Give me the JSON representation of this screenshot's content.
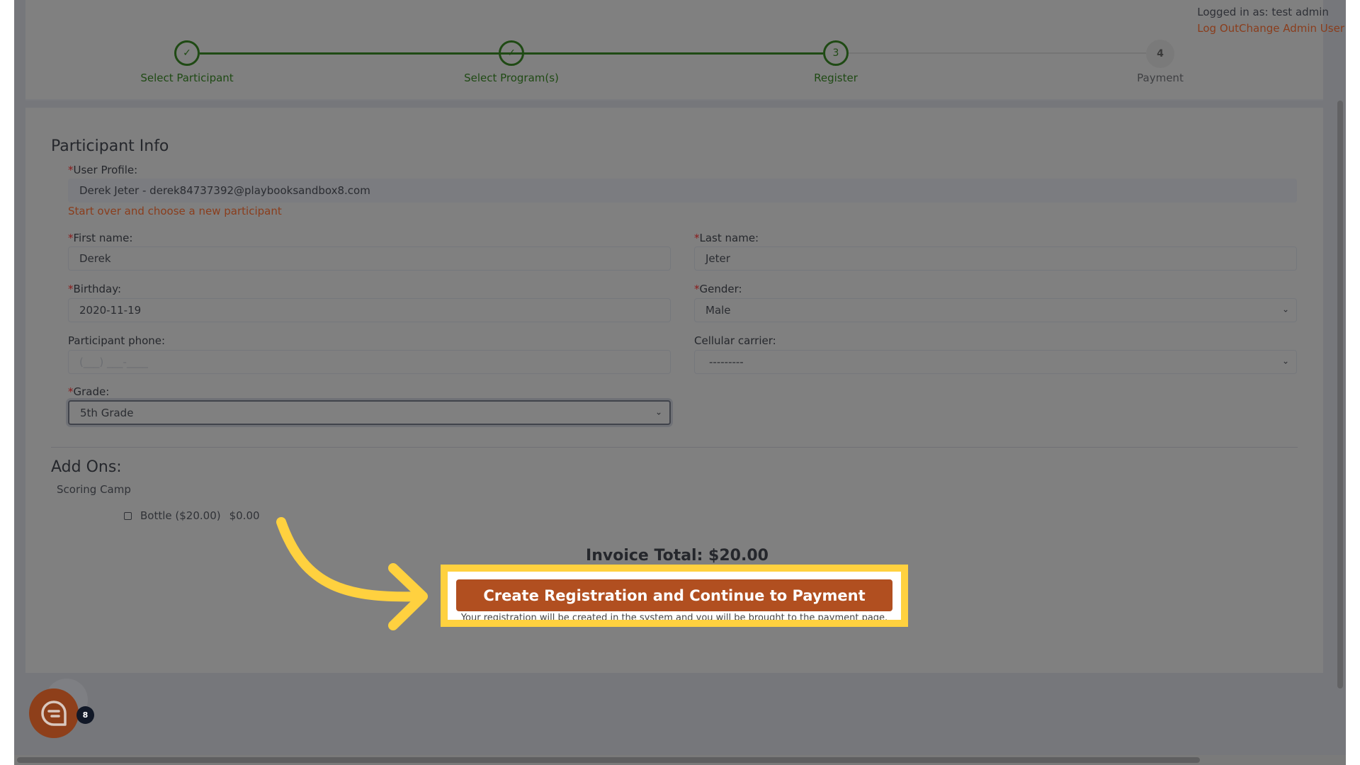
{
  "header": {
    "logged_in_text": "Logged in as: test admin",
    "logout_link": "Log Out",
    "change_admin_link": "Change Admin User"
  },
  "stepper": {
    "steps": [
      {
        "label": "Select Participant",
        "state": "done",
        "marker": "✓"
      },
      {
        "label": "Select Program(s)",
        "state": "done",
        "marker": "✓"
      },
      {
        "label": "Register",
        "state": "active",
        "marker": "3"
      },
      {
        "label": "Payment",
        "state": "todo",
        "marker": "4"
      }
    ],
    "colors": {
      "complete": "#1f4a14",
      "incomplete": "#757575"
    }
  },
  "participant_info": {
    "title": "Participant Info",
    "required_marker": "*",
    "user_profile": {
      "label": "User Profile:",
      "value": "Derek Jeter - derek84737392@playbooksandbox8.com"
    },
    "start_over_link": "Start over and choose a new participant",
    "first_name": {
      "label": "First name:",
      "value": "Derek"
    },
    "last_name": {
      "label": "Last name:",
      "value": "Jeter"
    },
    "birthday": {
      "label": "Birthday:",
      "value": "2020-11-19"
    },
    "gender": {
      "label": "Gender:",
      "value": "Male"
    },
    "phone": {
      "label": "Participant phone:",
      "value": "",
      "placeholder": "(___) ___-____"
    },
    "carrier": {
      "label": "Cellular carrier:",
      "value": "---------"
    },
    "grade": {
      "label": "Grade:",
      "value": "5th Grade"
    }
  },
  "add_ons": {
    "title": "Add Ons:",
    "group": "Scoring Camp",
    "items": [
      {
        "name": "Bottle ($20.00)",
        "price": "$0.00",
        "checked": false
      }
    ]
  },
  "invoice_total": "Invoice Total: $20.00",
  "cta": {
    "label": "Create Registration and Continue to Payment",
    "note": "Your registration will be created in the system and you will be brought to the payment page."
  },
  "chat_widget": {
    "badge_count": "8"
  },
  "accent_colors": {
    "brand": "#b14f20",
    "highlight": "#ffd13f",
    "link": "#8a3d1c"
  }
}
